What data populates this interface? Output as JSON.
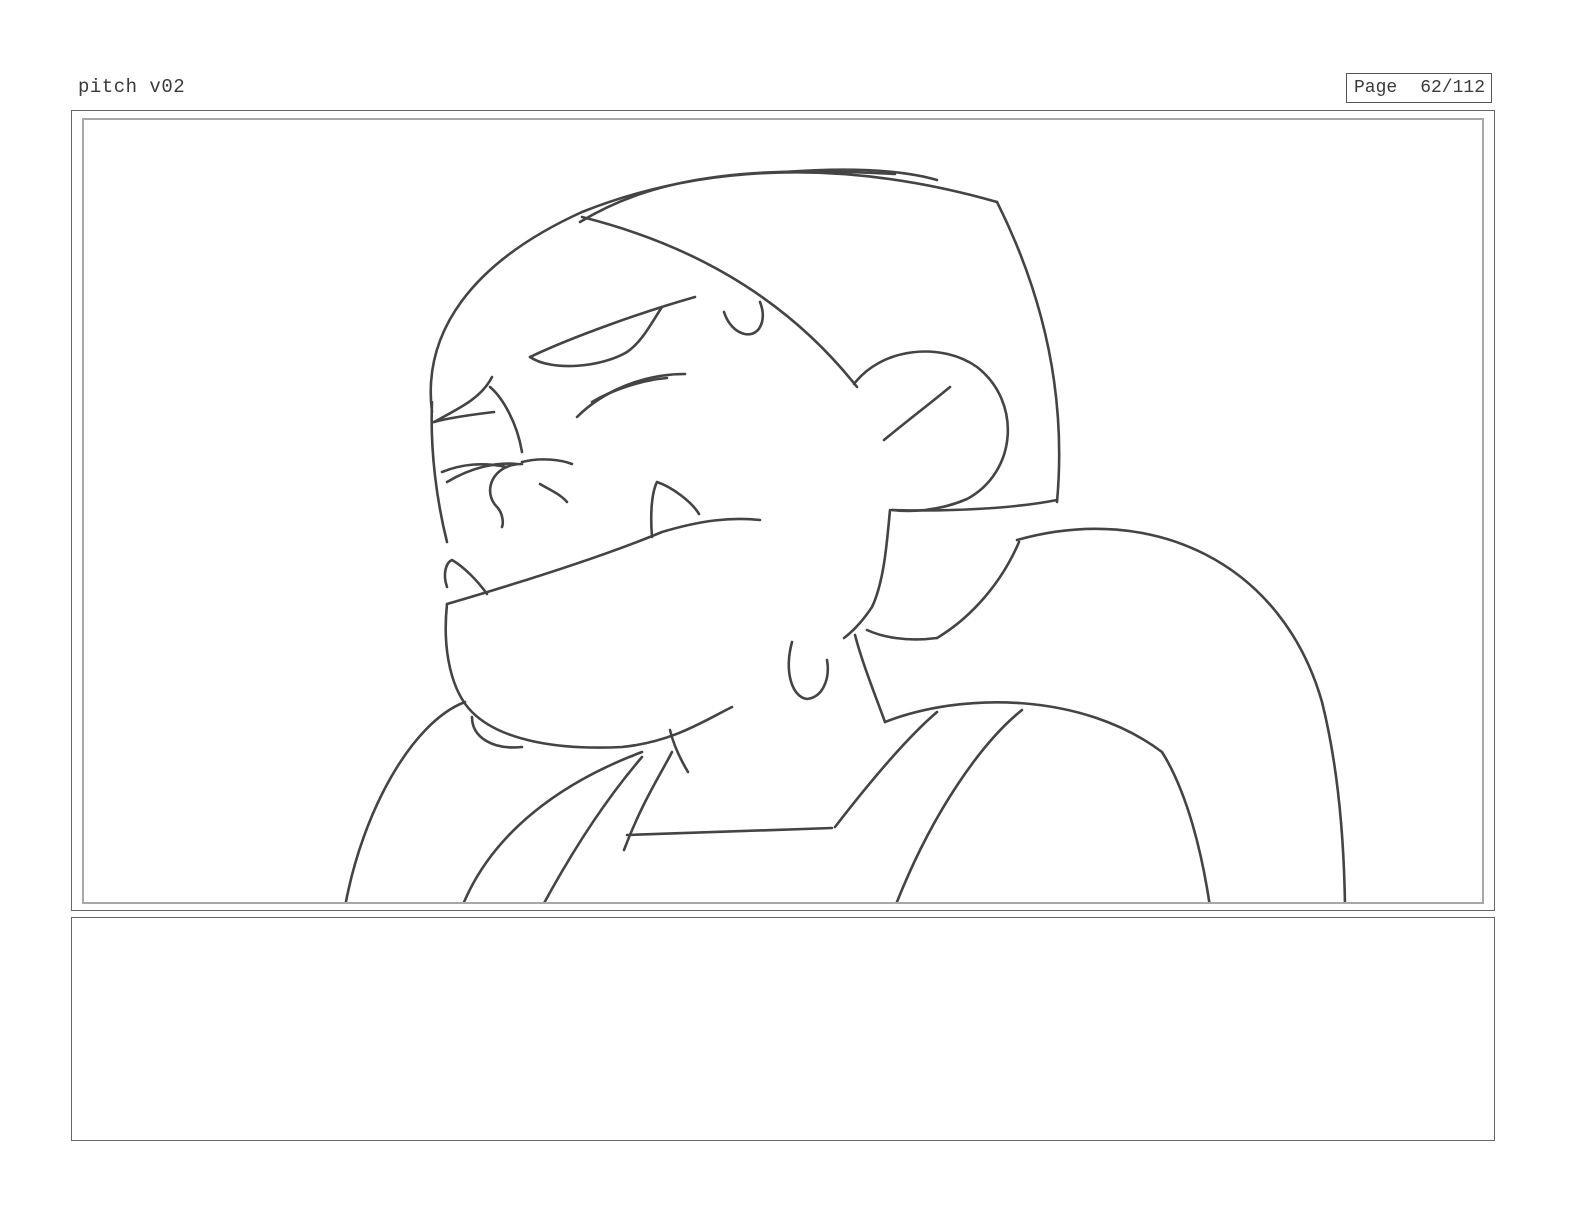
{
  "header": {
    "document_title": "pitch v02",
    "page_label": "Page",
    "page_number": "62/112"
  },
  "panel": {
    "sketch_icon": "character-sketch-drawing",
    "line_color": "#444444",
    "frame_color": "#a8a8a8"
  },
  "notes": {
    "text": ""
  }
}
